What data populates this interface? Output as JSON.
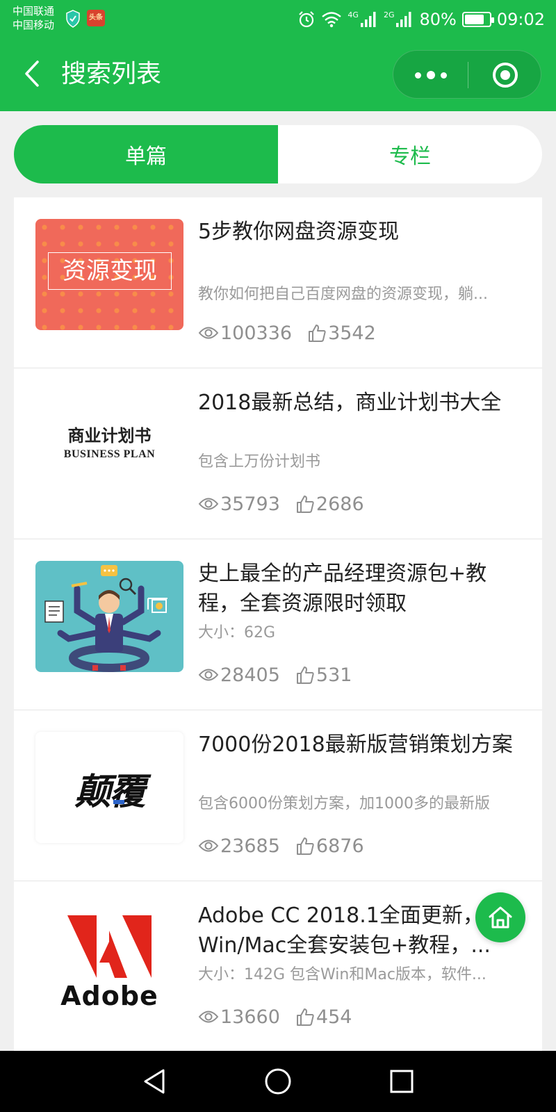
{
  "status_bar": {
    "carrier_1": "中国联通",
    "carrier_2": "中国移动",
    "news_badge": "头条",
    "network_1": "4G",
    "network_2": "2G",
    "battery": "80%",
    "battery_level": 0.8,
    "time": "09:02"
  },
  "header": {
    "title": "搜索列表",
    "icons": [
      "back-arrow-icon",
      "more-dots-icon",
      "close-circle-icon"
    ]
  },
  "tabs": [
    {
      "label": "单篇",
      "active": true
    },
    {
      "label": "专栏",
      "active": false
    }
  ],
  "items": [
    {
      "title": "5步教你网盘资源变现",
      "desc": "教你如何把自己百度网盘的资源变现，躺...",
      "views": "100336",
      "likes": "3542",
      "thumb_text": "资源变现"
    },
    {
      "title": "2018最新总结，商业计划书大全",
      "desc": "包含上万份计划书",
      "views": "35793",
      "likes": "2686",
      "thumb_text": "商业计划书",
      "thumb_subtext": "BUSINESS PLAN"
    },
    {
      "title": "史上最全的产品经理资源包+教程，全套资源限时领取",
      "desc": "大小：62G",
      "views": "28405",
      "likes": "531"
    },
    {
      "title": "7000份2018最新版营销策划方案",
      "desc": "包含6000份策划方案，加1000多的最新版",
      "views": "23685",
      "likes": "6876",
      "thumb_text": "颠覆"
    },
    {
      "title": "Adobe CC 2018.1全面更新，Win/Mac全套安装包+教程，...",
      "desc": "大小：142G   包含Win和Mac版本，软件...",
      "views": "13660",
      "likes": "454",
      "thumb_text": "Adobe"
    }
  ],
  "colors": {
    "brand_green": "#1dbb4c",
    "adobe_red": "#e1251b"
  }
}
